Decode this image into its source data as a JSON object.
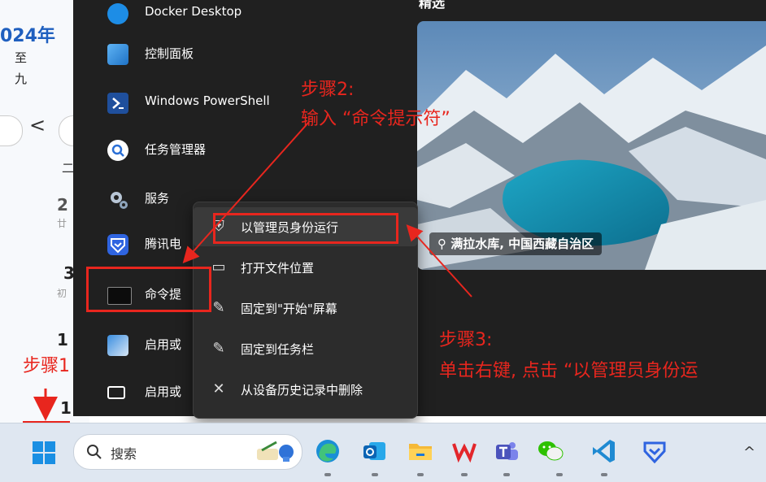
{
  "calendar": {
    "year_title": "024年",
    "line1": "至",
    "line2": "九",
    "prev_glyph": "<",
    "weekday": "二",
    "cells": [
      {
        "day": "2",
        "sub": "廿"
      },
      {
        "day": "3",
        "sub": "初"
      },
      {
        "day": "1",
        "sub": ""
      },
      {
        "day": "1",
        "sub": ""
      }
    ]
  },
  "start_menu": {
    "top_label": "Docker Desktop",
    "apps": [
      {
        "label": "控制面板",
        "icon": "control-panel-icon"
      },
      {
        "label": "Windows PowerShell",
        "icon": "powershell-icon"
      },
      {
        "label": "任务管理器",
        "icon": "task-manager-icon"
      },
      {
        "label": "服务",
        "icon": "services-gear-icon"
      },
      {
        "label": "腾讯电",
        "icon": "tencent-pc-manager-icon"
      },
      {
        "label": "命令提",
        "icon": "command-prompt-icon"
      },
      {
        "label": "启用或",
        "icon": "windows-features-icon"
      },
      {
        "label": "启用或",
        "icon": "toggle-icon"
      }
    ]
  },
  "wallpaper": {
    "header": "精选",
    "location": "满拉水库, 中国西藏自治区",
    "pin_icon": "location-pin-icon"
  },
  "context_menu": {
    "items": [
      {
        "label": "以管理员身份运行",
        "icon": "shield-run-icon",
        "glyph": "⛨"
      },
      {
        "label": "打开文件位置",
        "icon": "folder-icon",
        "glyph": "▭"
      },
      {
        "label": "固定到\"开始\"屏幕",
        "icon": "pin-icon",
        "glyph": "✎"
      },
      {
        "label": "固定到任务栏",
        "icon": "pin-icon",
        "glyph": "✎"
      },
      {
        "label": "从设备历史记录中删除",
        "icon": "close-icon",
        "glyph": "✕"
      }
    ]
  },
  "annotations": {
    "step1": "步骤1",
    "step2_title": "步骤2:",
    "step2_body": "输入 “命令提示符”",
    "step3_title": "步骤3:",
    "step3_body": "单击右键, 点击 “以管理员身份运",
    "color": "#e8261e"
  },
  "taskbar": {
    "search_label": "搜索",
    "chevron": "^",
    "icons": [
      "start-icon",
      "search-icon",
      "weather-widget-icon",
      "edge-icon",
      "outlook-icon",
      "file-explorer-icon",
      "wps-icon",
      "teams-icon",
      "wechat-icon",
      "vscode-icon",
      "tencent-pc-manager-icon",
      "chevron-up-icon"
    ]
  }
}
